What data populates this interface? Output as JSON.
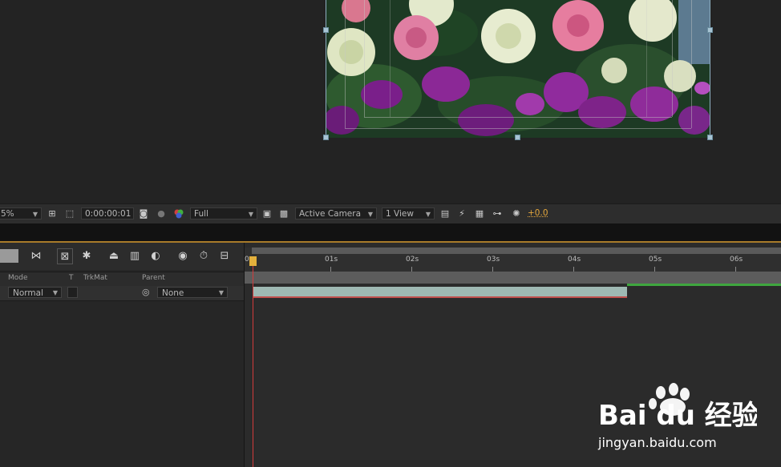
{
  "viewer_toolbar": {
    "zoom": "5%",
    "timecode": "0:00:00:01",
    "resolution": "Full",
    "camera": "Active Camera",
    "views": "1 View",
    "exposure": "+0.0"
  },
  "timeline": {
    "columns": {
      "mode": "Mode",
      "t": "T",
      "trkmat": "TrkMat",
      "parent": "Parent"
    },
    "layer": {
      "mode": "Normal",
      "parent": "None"
    },
    "ruler_labels": [
      "0s",
      "01s",
      "02s",
      "03s",
      "04s",
      "05s",
      "06s"
    ]
  },
  "watermark": {
    "brand": "Bai du 经验",
    "url": "jingyan.baidu.com"
  },
  "colors": {
    "accent": "#a87b2a",
    "playhead": "#d23b3b",
    "layer_bar": "#9fb9b3",
    "exposure": "#e3a63c"
  },
  "icons": [
    "region-icon",
    "transparency-grid-icon",
    "snapshot-icon",
    "show-snapshot-icon",
    "channel-icon",
    "fast-preview-icon",
    "flowchart-icon",
    "pixel-aspect-icon",
    "exposure-reset-icon"
  ]
}
